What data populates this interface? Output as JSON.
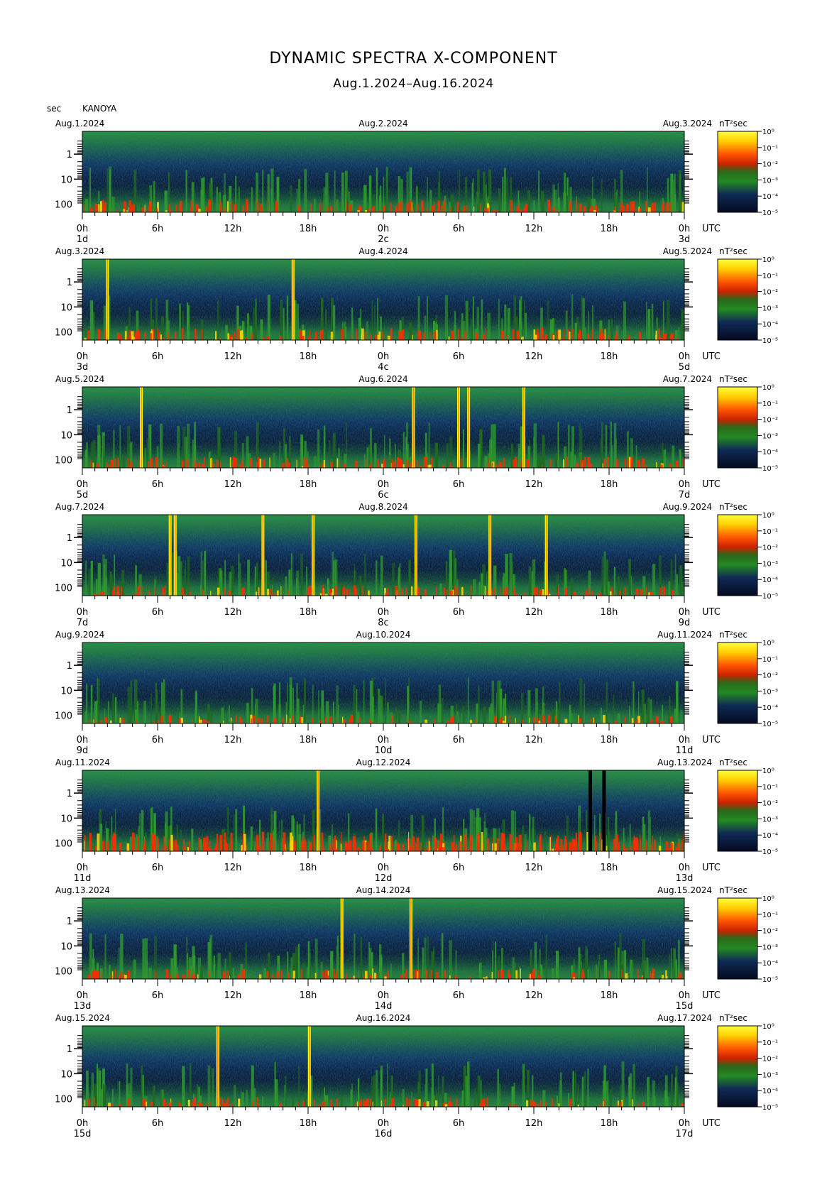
{
  "title": "DYNAMIC SPECTRA X-COMPONENT",
  "subtitle": "Aug.1.2024–Aug.16.2024",
  "y_unit_label": "sec",
  "station": "KANOYA",
  "colorbar_unit": "nT²sec",
  "colorbar_labels": [
    "10⁰",
    "10⁻¹",
    "10⁻²",
    "10⁻³",
    "10⁻⁴",
    "10⁻⁵"
  ],
  "y_tick_labels": [
    "1",
    "10",
    "100"
  ],
  "x_tick_labels": [
    "0h",
    "6h",
    "12h",
    "18h",
    "0h",
    "6h",
    "12h",
    "18h",
    "0h"
  ],
  "utc_label": "UTC",
  "colors": {
    "dark": "#0a0e2a",
    "blue": "#14366b",
    "green": "#2a8a2a",
    "red": "#ff2a00",
    "yellow": "#ffff00"
  },
  "chart_data": {
    "type": "heatmap",
    "x_unit": "hours UTC",
    "y_unit": "period (sec), log scale",
    "y_ticks": [
      1,
      10,
      100
    ],
    "color_scale": {
      "unit": "nT²sec",
      "log10_min": -5,
      "log10_max": 0
    },
    "panels": [
      {
        "left_date": "Aug.1.2024",
        "mid_date": "Aug.2.2024",
        "right_date": "Aug.3.2024",
        "day_labels": [
          "1d",
          "2c",
          "3d"
        ],
        "spikes": [],
        "dark_bars": [],
        "activity": 0.5
      },
      {
        "left_date": "Aug.3.2024",
        "mid_date": "Aug.4.2024",
        "right_date": "Aug.5.2024",
        "day_labels": [
          "3d",
          "4c",
          "5d"
        ],
        "spikes": [
          2.0,
          16.8
        ],
        "dark_bars": [],
        "activity": 0.45
      },
      {
        "left_date": "Aug.5.2024",
        "mid_date": "Aug.6.2024",
        "right_date": "Aug.7.2024",
        "day_labels": [
          "5d",
          "6c",
          "7d"
        ],
        "spikes": [
          4.7,
          26.4,
          30.0,
          30.8,
          35.2
        ],
        "dark_bars": [],
        "activity": 0.4
      },
      {
        "left_date": "Aug.7.2024",
        "mid_date": "Aug.8.2024",
        "right_date": "Aug.9.2024",
        "day_labels": [
          "7d",
          "8c",
          "9d"
        ],
        "spikes": [
          7.0,
          7.4,
          14.4,
          18.4,
          26.6,
          32.5,
          37.0
        ],
        "dark_bars": [],
        "activity": 0.35
      },
      {
        "left_date": "Aug.9.2024",
        "mid_date": "Aug.10.2024",
        "right_date": "Aug.11.2024",
        "day_labels": [
          "9d",
          "10d",
          "11d"
        ],
        "spikes": [],
        "dark_bars": [],
        "activity": 0.25
      },
      {
        "left_date": "Aug.11.2024",
        "mid_date": "Aug.12.2024",
        "right_date": "Aug.13.2024",
        "day_labels": [
          "11d",
          "12d",
          "13d"
        ],
        "spikes": [
          18.8
        ],
        "dark_bars": [
          40.5,
          41.6
        ],
        "activity": 0.9
      },
      {
        "left_date": "Aug.13.2024",
        "mid_date": "Aug.14.2024",
        "right_date": "Aug.15.2024",
        "day_labels": [
          "13d",
          "14d",
          "15d"
        ],
        "spikes": [
          20.7,
          26.2
        ],
        "dark_bars": [],
        "activity": 0.35
      },
      {
        "left_date": "Aug.15.2024",
        "mid_date": "Aug.16.2024",
        "right_date": "Aug.17.2024",
        "day_labels": [
          "15d",
          "16d",
          "17d"
        ],
        "spikes": [
          10.8,
          18.1
        ],
        "dark_bars": [],
        "activity": 0.3
      }
    ]
  }
}
